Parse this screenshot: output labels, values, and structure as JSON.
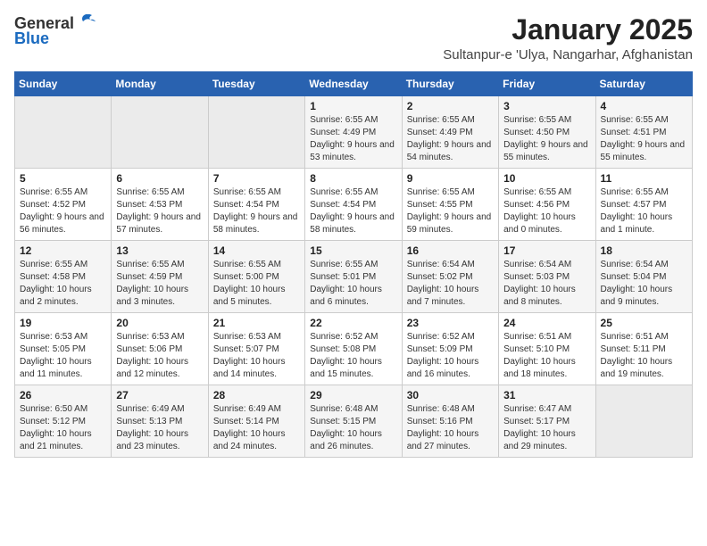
{
  "header": {
    "logo_general": "General",
    "logo_blue": "Blue",
    "title": "January 2025",
    "subtitle": "Sultanpur-e 'Ulya, Nangarhar, Afghanistan"
  },
  "days_of_week": [
    "Sunday",
    "Monday",
    "Tuesday",
    "Wednesday",
    "Thursday",
    "Friday",
    "Saturday"
  ],
  "weeks": [
    {
      "cells": [
        {
          "day": null
        },
        {
          "day": null
        },
        {
          "day": null
        },
        {
          "day": "1",
          "sunrise": "6:55 AM",
          "sunset": "4:49 PM",
          "daylight": "9 hours and 53 minutes."
        },
        {
          "day": "2",
          "sunrise": "6:55 AM",
          "sunset": "4:49 PM",
          "daylight": "9 hours and 54 minutes."
        },
        {
          "day": "3",
          "sunrise": "6:55 AM",
          "sunset": "4:50 PM",
          "daylight": "9 hours and 55 minutes."
        },
        {
          "day": "4",
          "sunrise": "6:55 AM",
          "sunset": "4:51 PM",
          "daylight": "9 hours and 55 minutes."
        }
      ]
    },
    {
      "cells": [
        {
          "day": "5",
          "sunrise": "6:55 AM",
          "sunset": "4:52 PM",
          "daylight": "9 hours and 56 minutes."
        },
        {
          "day": "6",
          "sunrise": "6:55 AM",
          "sunset": "4:53 PM",
          "daylight": "9 hours and 57 minutes."
        },
        {
          "day": "7",
          "sunrise": "6:55 AM",
          "sunset": "4:54 PM",
          "daylight": "9 hours and 58 minutes."
        },
        {
          "day": "8",
          "sunrise": "6:55 AM",
          "sunset": "4:54 PM",
          "daylight": "9 hours and 58 minutes."
        },
        {
          "day": "9",
          "sunrise": "6:55 AM",
          "sunset": "4:55 PM",
          "daylight": "9 hours and 59 minutes."
        },
        {
          "day": "10",
          "sunrise": "6:55 AM",
          "sunset": "4:56 PM",
          "daylight": "10 hours and 0 minutes."
        },
        {
          "day": "11",
          "sunrise": "6:55 AM",
          "sunset": "4:57 PM",
          "daylight": "10 hours and 1 minute."
        }
      ]
    },
    {
      "cells": [
        {
          "day": "12",
          "sunrise": "6:55 AM",
          "sunset": "4:58 PM",
          "daylight": "10 hours and 2 minutes."
        },
        {
          "day": "13",
          "sunrise": "6:55 AM",
          "sunset": "4:59 PM",
          "daylight": "10 hours and 3 minutes."
        },
        {
          "day": "14",
          "sunrise": "6:55 AM",
          "sunset": "5:00 PM",
          "daylight": "10 hours and 5 minutes."
        },
        {
          "day": "15",
          "sunrise": "6:55 AM",
          "sunset": "5:01 PM",
          "daylight": "10 hours and 6 minutes."
        },
        {
          "day": "16",
          "sunrise": "6:54 AM",
          "sunset": "5:02 PM",
          "daylight": "10 hours and 7 minutes."
        },
        {
          "day": "17",
          "sunrise": "6:54 AM",
          "sunset": "5:03 PM",
          "daylight": "10 hours and 8 minutes."
        },
        {
          "day": "18",
          "sunrise": "6:54 AM",
          "sunset": "5:04 PM",
          "daylight": "10 hours and 9 minutes."
        }
      ]
    },
    {
      "cells": [
        {
          "day": "19",
          "sunrise": "6:53 AM",
          "sunset": "5:05 PM",
          "daylight": "10 hours and 11 minutes."
        },
        {
          "day": "20",
          "sunrise": "6:53 AM",
          "sunset": "5:06 PM",
          "daylight": "10 hours and 12 minutes."
        },
        {
          "day": "21",
          "sunrise": "6:53 AM",
          "sunset": "5:07 PM",
          "daylight": "10 hours and 14 minutes."
        },
        {
          "day": "22",
          "sunrise": "6:52 AM",
          "sunset": "5:08 PM",
          "daylight": "10 hours and 15 minutes."
        },
        {
          "day": "23",
          "sunrise": "6:52 AM",
          "sunset": "5:09 PM",
          "daylight": "10 hours and 16 minutes."
        },
        {
          "day": "24",
          "sunrise": "6:51 AM",
          "sunset": "5:10 PM",
          "daylight": "10 hours and 18 minutes."
        },
        {
          "day": "25",
          "sunrise": "6:51 AM",
          "sunset": "5:11 PM",
          "daylight": "10 hours and 19 minutes."
        }
      ]
    },
    {
      "cells": [
        {
          "day": "26",
          "sunrise": "6:50 AM",
          "sunset": "5:12 PM",
          "daylight": "10 hours and 21 minutes."
        },
        {
          "day": "27",
          "sunrise": "6:49 AM",
          "sunset": "5:13 PM",
          "daylight": "10 hours and 23 minutes."
        },
        {
          "day": "28",
          "sunrise": "6:49 AM",
          "sunset": "5:14 PM",
          "daylight": "10 hours and 24 minutes."
        },
        {
          "day": "29",
          "sunrise": "6:48 AM",
          "sunset": "5:15 PM",
          "daylight": "10 hours and 26 minutes."
        },
        {
          "day": "30",
          "sunrise": "6:48 AM",
          "sunset": "5:16 PM",
          "daylight": "10 hours and 27 minutes."
        },
        {
          "day": "31",
          "sunrise": "6:47 AM",
          "sunset": "5:17 PM",
          "daylight": "10 hours and 29 minutes."
        },
        {
          "day": null
        }
      ]
    }
  ],
  "labels": {
    "sunrise_label": "Sunrise:",
    "sunset_label": "Sunset:",
    "daylight_label": "Daylight:"
  }
}
